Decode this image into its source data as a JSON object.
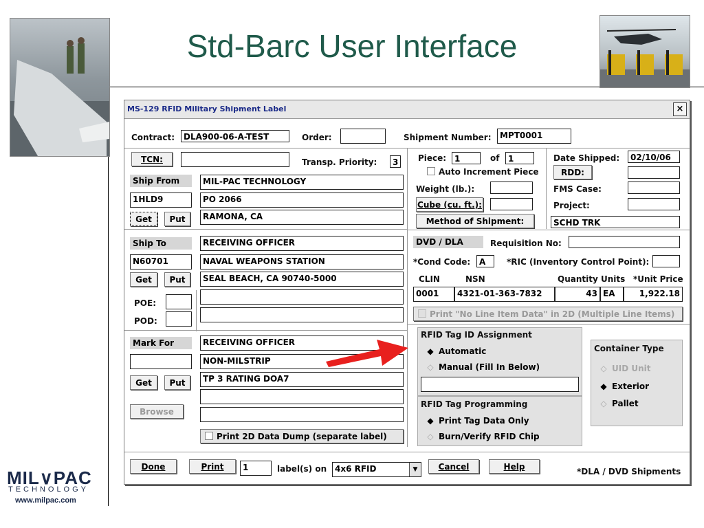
{
  "slide": {
    "title": "Std-Barc User Interface"
  },
  "logo": {
    "main": "MIL∨PAC",
    "sub": "TECHNOLOGY",
    "url": "www.milpac.com"
  },
  "window": {
    "title": "MS-129 RFID Military Shipment Label",
    "close": "×"
  },
  "top": {
    "contract_label": "Contract:",
    "contract_value": "DLA900-06-A-TEST",
    "order_label": "Order:",
    "order_value": "",
    "shipment_label": "Shipment Number:",
    "shipment_value": "MPT0001",
    "tcn_button": "TCN:",
    "tcn_value": "",
    "priority_label": "Transp. Priority:",
    "priority_value": "3"
  },
  "piece": {
    "piece_label": "Piece:",
    "piece_value": "1",
    "of_label": "of",
    "of_value": "1",
    "auto_increment": "Auto Increment Piece",
    "weight_label": "Weight (lb.):",
    "weight_value": "",
    "cube_button": "Cube (cu. ft.):",
    "cube_value": "",
    "method_button": "Method of Shipment:",
    "method_value": "SCHD TRK"
  },
  "dates": {
    "shipped_label": "Date Shipped:",
    "shipped_value": "02/10/06",
    "rdd_button": "RDD:",
    "rdd_value": "",
    "fms_label": "FMS Case:",
    "fms_value": "",
    "project_label": "Project:",
    "project_value": ""
  },
  "ship_from": {
    "header": "Ship From",
    "code": "1HLD9",
    "line1": "MIL-PAC TECHNOLOGY",
    "line2": "PO 2066",
    "line3": "RAMONA, CA",
    "get": "Get",
    "put": "Put"
  },
  "ship_to": {
    "header": "Ship To",
    "code": "N60701",
    "line1": "RECEIVING OFFICER",
    "line2": "NAVAL WEAPONS STATION",
    "line3": "SEAL BEACH,  CA  90740-5000",
    "line4": "",
    "line5": "",
    "get": "Get",
    "put": "Put",
    "poe_label": "POE:",
    "poe_value": "",
    "pod_label": "POD:",
    "pod_value": ""
  },
  "mark_for": {
    "header": "Mark For",
    "code": "",
    "line1": "RECEIVING OFFICER",
    "line2": "NON-MILSTRIP",
    "line3": "TP 3 RATING DOA7",
    "line4": "",
    "line5": "",
    "get": "Get",
    "put": "Put",
    "browse": "Browse"
  },
  "dvd": {
    "header": "DVD / DLA",
    "requisition_label": "Requisition No:",
    "requisition_value": "",
    "cond_label": "*Cond Code:",
    "cond_value": "A",
    "ric_label": "*RIC (Inventory Control Point):",
    "ric_value": "",
    "columns": [
      "CLIN",
      "NSN",
      "Quantity",
      "Units",
      "*Unit Price"
    ],
    "row": {
      "clin": "0001",
      "nsn": "4321-01-363-7832",
      "quantity": "43",
      "units": "EA",
      "price": "1,922.18"
    },
    "no_line_item": "Print \"No Line Item Data\" in 2D (Multiple Line Items)"
  },
  "rfid_assign": {
    "header": "RFID Tag ID Assignment",
    "automatic": "Automatic",
    "manual": "Manual (Fill In Below)",
    "value": ""
  },
  "rfid_prog": {
    "header": "RFID Tag Programming",
    "print_only": "Print Tag Data Only",
    "burn": "Burn/Verify RFID Chip"
  },
  "container": {
    "header": "Container Type",
    "uid": "UID Unit",
    "exterior": "Exterior",
    "pallet": "Pallet"
  },
  "print_dump": "Print 2D Data Dump (separate label)",
  "bottom": {
    "done": "Done",
    "print": "Print",
    "count": "1",
    "labels_on": "label(s) on",
    "format": "4x6 RFID",
    "cancel": "Cancel",
    "help": "Help",
    "note": "*DLA / DVD Shipments"
  },
  "colors": {
    "title": "#1f5a4a",
    "arrow": "#e8201e",
    "window_title": "#1a2a88"
  }
}
